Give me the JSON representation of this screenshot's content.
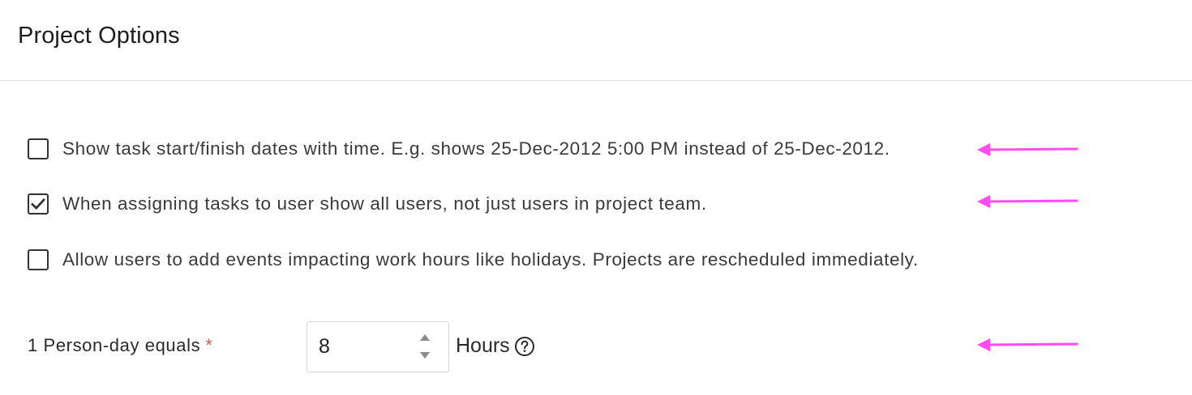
{
  "header": {
    "title": "Project Options"
  },
  "options": [
    {
      "label": "Show task start/finish dates with time. E.g. shows 25-Dec-2012 5:00 PM instead of 25-Dec-2012.",
      "checked": false
    },
    {
      "label": "When assigning tasks to user show all users, not just users in project team.",
      "checked": true
    },
    {
      "label": "Allow users to add events impacting work hours like holidays. Projects are rescheduled immediately.",
      "checked": false
    }
  ],
  "person_day": {
    "label": "1 Person-day equals",
    "required_marker": "*",
    "value": "8",
    "unit": "Hours"
  },
  "colors": {
    "annotation_arrow": "#ff4cf0",
    "required": "#e5533d",
    "checkbox_border": "#333333"
  },
  "icons": {
    "help": "question-circle-icon",
    "check": "checkmark-icon",
    "spin_up": "triangle-up-icon",
    "spin_down": "triangle-down-icon",
    "annotation": "left-arrow-icon"
  }
}
